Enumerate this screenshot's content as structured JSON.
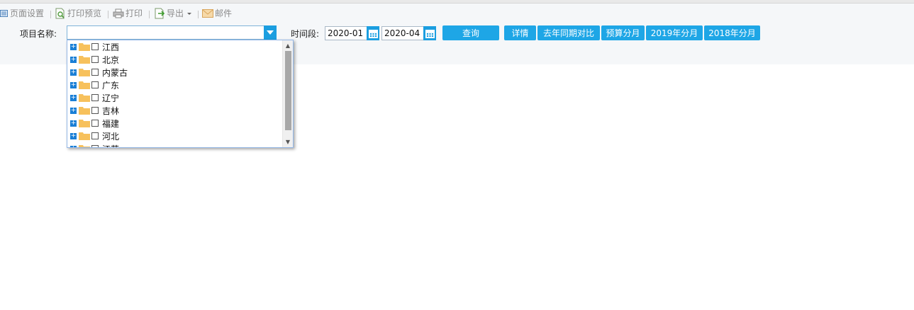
{
  "toolbar": {
    "page_setup": "页面设置",
    "print_preview": "打印预览",
    "print": "打印",
    "export": "导出",
    "mail": "邮件"
  },
  "filter": {
    "project_label": "项目名称:",
    "project_value": "",
    "time_label": "时间段:",
    "start_date": "2020-01",
    "end_date": "2020-04"
  },
  "buttons": {
    "query": "查询",
    "details": "详情",
    "yoy": "去年同期对比",
    "budget_month": "预算分月",
    "month_2019": "2019年分月",
    "month_2018": "2018年分月"
  },
  "tree": {
    "items": [
      {
        "label": "江西"
      },
      {
        "label": "北京"
      },
      {
        "label": "内蒙古"
      },
      {
        "label": "广东"
      },
      {
        "label": "辽宁"
      },
      {
        "label": "吉林"
      },
      {
        "label": "福建"
      },
      {
        "label": "河北"
      },
      {
        "label": "江苏"
      }
    ]
  },
  "colors": {
    "accent": "#1ea6e6",
    "combo_border": "#7fb3d9",
    "expander": "#1a7fd6",
    "folder": "#f7c15c"
  },
  "icons": {
    "page_setup": "page-setup-icon",
    "print_preview": "print-preview-icon",
    "print": "printer-icon",
    "export": "export-icon",
    "mail": "envelope-icon",
    "calendar": "calendar-icon",
    "folder": "folder-icon"
  }
}
